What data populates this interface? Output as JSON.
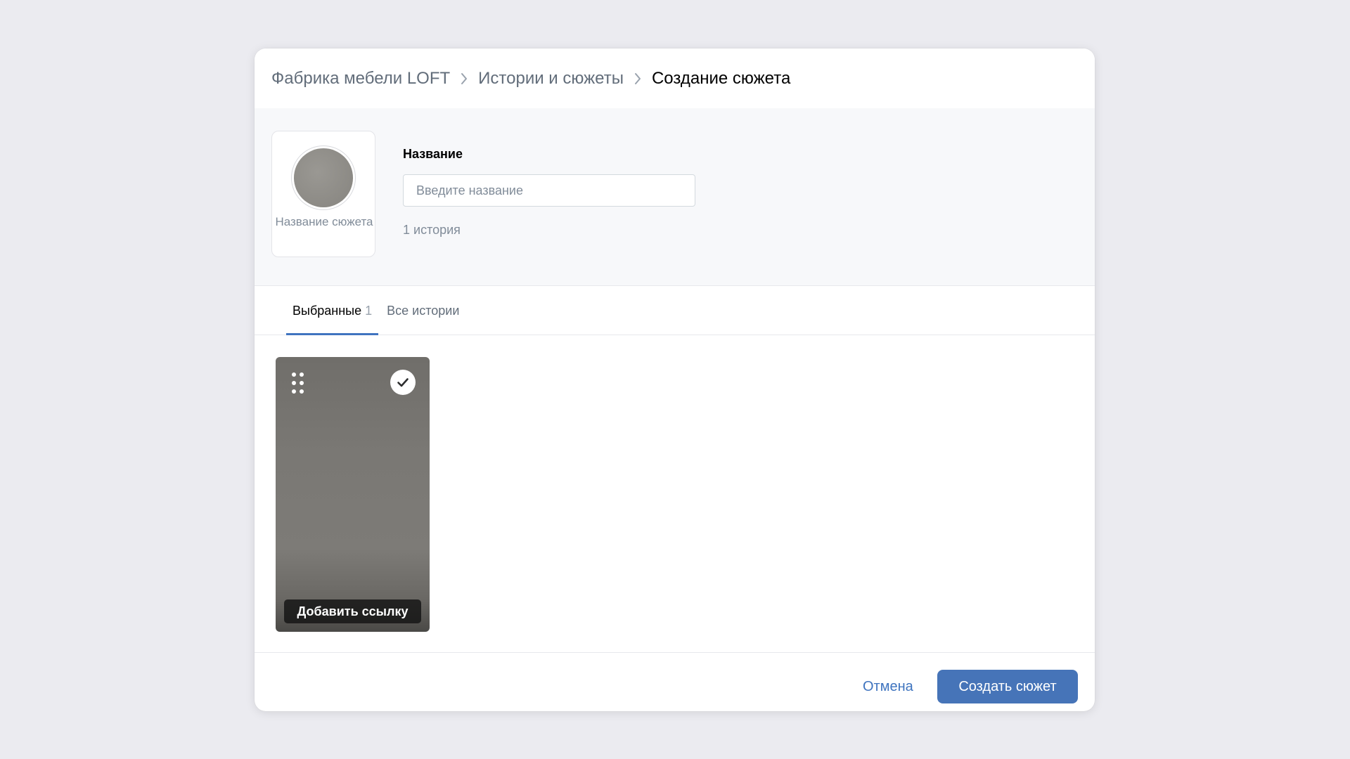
{
  "breadcrumb": {
    "items": [
      {
        "label": "Фабрика мебели LOFT"
      },
      {
        "label": "Истории и сюжеты"
      },
      {
        "label": "Создание сюжета"
      }
    ]
  },
  "cover": {
    "label": "Название сюжета"
  },
  "form": {
    "name_label": "Название",
    "name_value": "",
    "name_placeholder": "Введите название",
    "story_count": "1 история"
  },
  "tabs": [
    {
      "label": "Выбранные",
      "count": "1",
      "active": true
    },
    {
      "label": "Все истории",
      "count": "",
      "active": false
    }
  ],
  "stories": [
    {
      "add_link_label": "Добавить ссылку",
      "selected": true
    }
  ],
  "footer": {
    "cancel_label": "Отмена",
    "create_label": "Создать сюжет"
  },
  "colors": {
    "accent": "#3f74bf",
    "primary_button": "#4674b8",
    "page_background": "#ebebf0",
    "muted_text": "#818c99"
  },
  "icons": {
    "breadcrumb_separator": "chevron-right-icon",
    "drag": "drag-handle-icon",
    "selected": "checkmark-icon"
  }
}
